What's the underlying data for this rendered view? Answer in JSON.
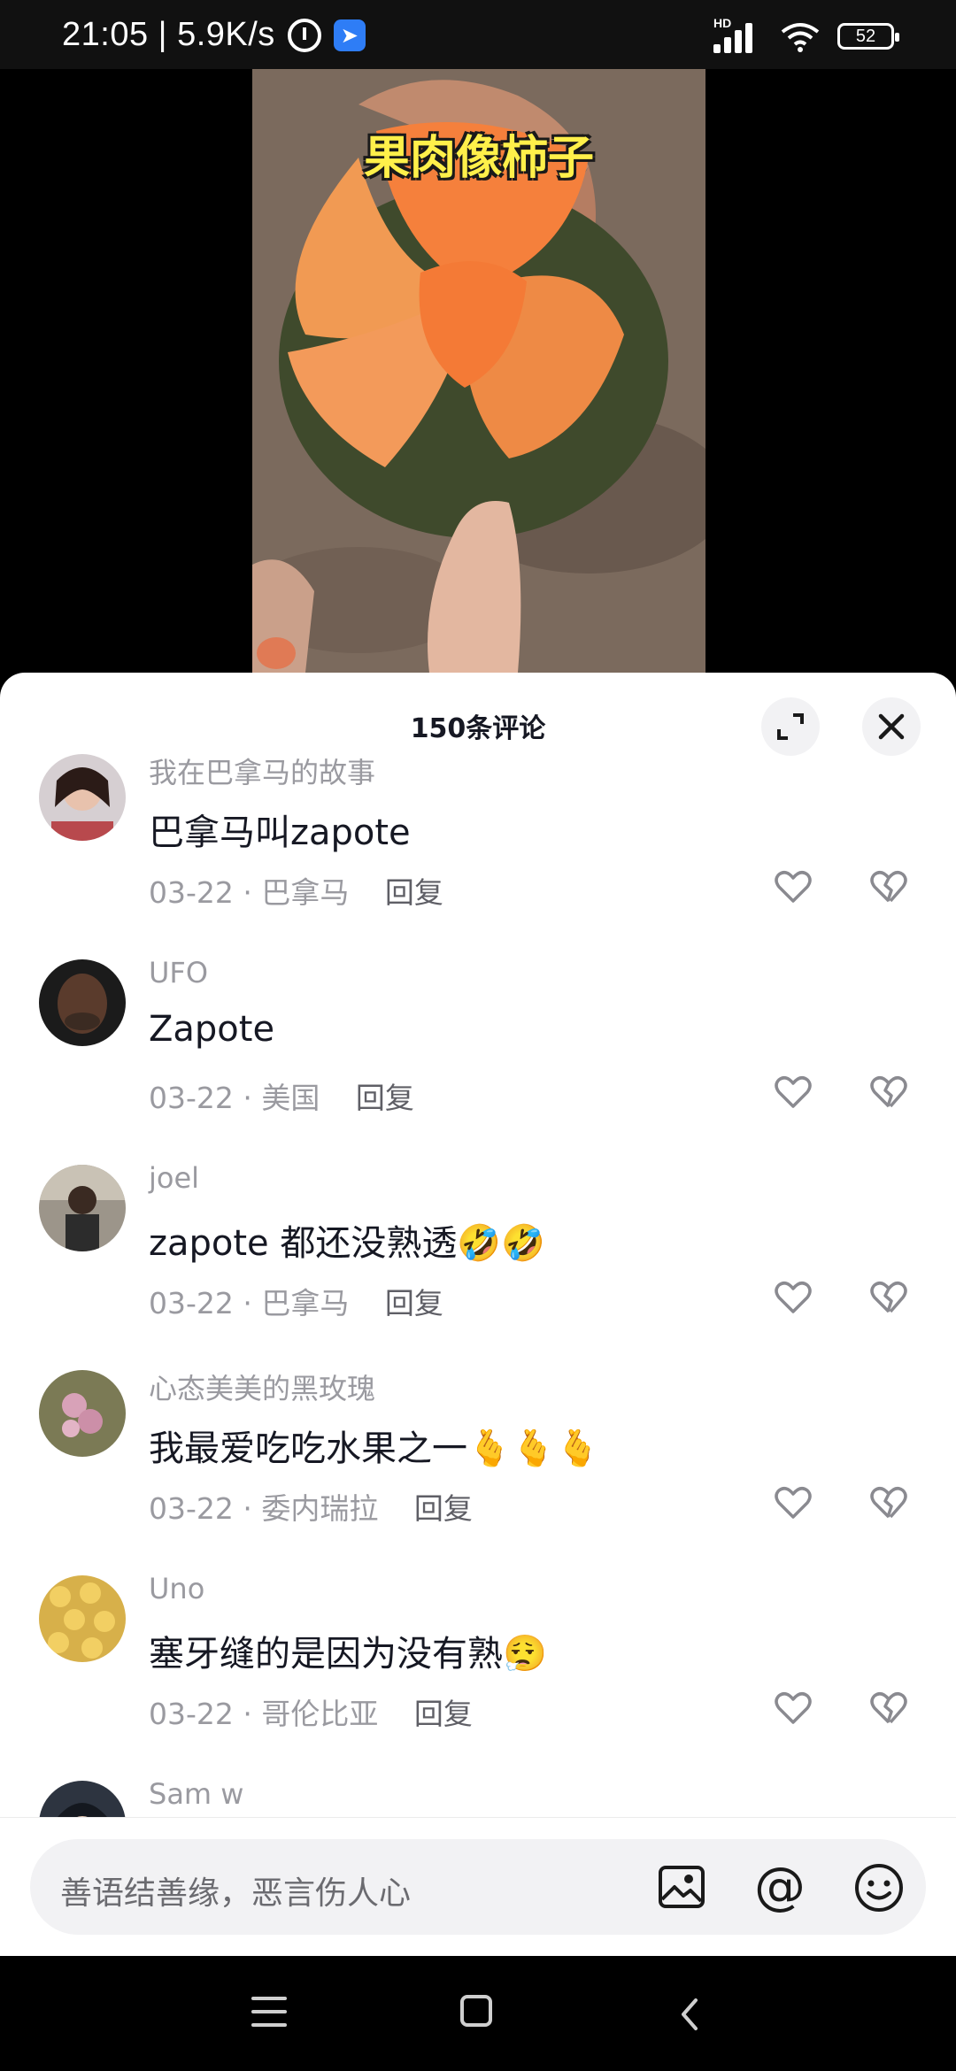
{
  "status_bar": {
    "time_speed": "21:05 | 5.9K/s",
    "app_badge": "➤",
    "network": "HD",
    "battery": "52"
  },
  "video": {
    "caption": "果肉像柿子"
  },
  "comments_panel": {
    "title": "150条评论",
    "comments": [
      {
        "user": "我在巴拿马的故事",
        "text": "巴拿马叫zapote",
        "date": "03-22",
        "location": "巴拿马",
        "reply": "回复",
        "avatar_color": "#b8494d"
      },
      {
        "user": "UFO",
        "text": "Zapote",
        "date": "03-22",
        "location": "美国",
        "reply": "回复",
        "avatar_color": "#3b2b22"
      },
      {
        "user": "joel",
        "text": "zapote 都还没熟透🤣🤣",
        "date": "03-22",
        "location": "巴拿马",
        "reply": "回复",
        "avatar_color": "#6d6a63"
      },
      {
        "user": "心态美美的黑玫瑰",
        "text": "我最爱吃吃水果之一🫰🫰🫰",
        "date": "03-22",
        "location": "委内瑞拉",
        "reply": "回复",
        "avatar_color": "#8a7a60"
      },
      {
        "user": "Uno",
        "text": "塞牙缝的是因为没有熟😮‍💨",
        "date": "03-22",
        "location": "哥伦比亚",
        "reply": "回复",
        "avatar_color": "#d7b04a"
      },
      {
        "user": "Sam w",
        "text": "",
        "date": "",
        "location": "",
        "reply": "",
        "avatar_color": "#2d3440"
      }
    ]
  },
  "input": {
    "placeholder": "善语结善缘，恶言伤人心",
    "at_symbol": "@"
  },
  "icons": {
    "like": "heart-icon",
    "dislike": "broken-heart-icon",
    "expand": "expand-icon",
    "close": "close-icon",
    "image": "image-icon",
    "emoji": "emoji-icon"
  }
}
